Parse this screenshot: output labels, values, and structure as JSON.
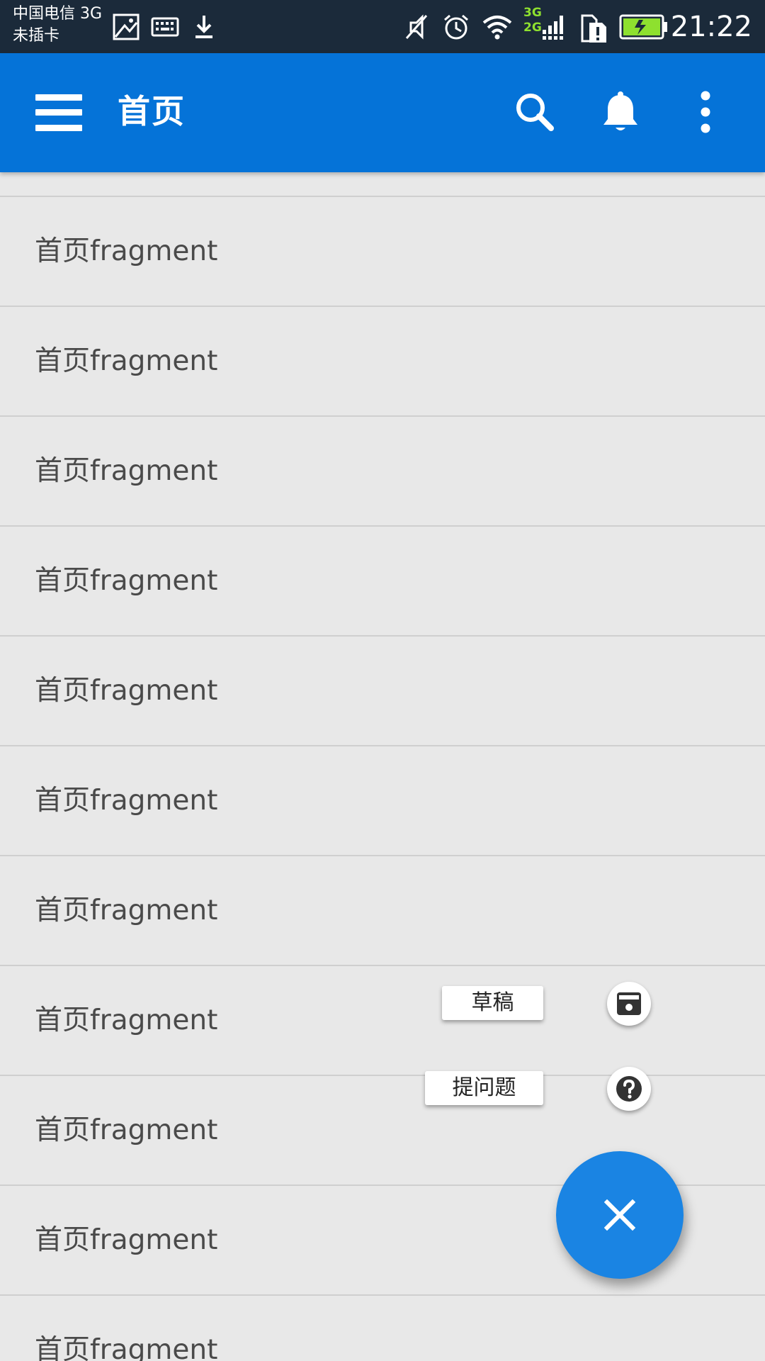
{
  "status_bar": {
    "carrier_line1": "中国电信 3G",
    "carrier_line2": "未插卡",
    "network_top": "3G",
    "network_bottom": "2G",
    "time": "21:22",
    "icons": [
      "image-icon",
      "keyboard-icon",
      "download-icon",
      "mute-icon",
      "alarm-icon",
      "wifi-icon",
      "signal-icon",
      "sim-icon",
      "battery-icon"
    ]
  },
  "app_bar": {
    "title": "首页",
    "icons": [
      "menu-icon",
      "search-icon",
      "bell-icon",
      "more-vert-icon"
    ],
    "color": "#0573d8"
  },
  "list": {
    "items": [
      "首页fragment",
      "首页fragment",
      "首页fragment",
      "首页fragment",
      "首页fragment",
      "首页fragment",
      "首页fragment",
      "首页fragment",
      "首页fragment",
      "首页fragment",
      "首页fragment"
    ]
  },
  "fab_menu": {
    "draft_label": "草稿",
    "draft_icon": "draft-icon",
    "ask_label": "提问题",
    "ask_icon": "help-icon",
    "main_icon": "close-icon",
    "main_color": "#1a84e3"
  }
}
